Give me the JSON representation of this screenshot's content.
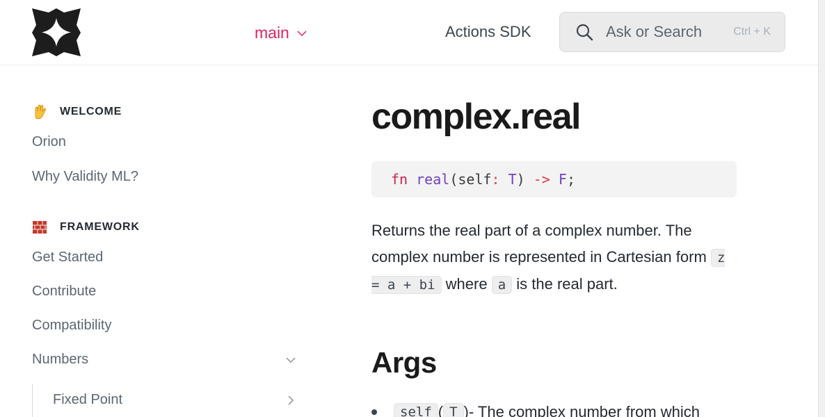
{
  "header": {
    "logo_name": "diamond-star-logo",
    "version": "main",
    "sdk_link": "Actions SDK",
    "search": {
      "placeholder": "Ask or Search",
      "shortcut": "Ctrl + K"
    }
  },
  "sidebar": {
    "sections": [
      {
        "emoji": "waving-hand",
        "title": "WELCOME",
        "items": [
          "Orion",
          "Why Validity ML?"
        ]
      },
      {
        "emoji": "brick",
        "title": "FRAMEWORK",
        "items": [
          "Get Started",
          "Contribute",
          "Compatibility",
          "Numbers"
        ]
      }
    ],
    "subitems": [
      "Fixed Point"
    ]
  },
  "content": {
    "title": "complex.real",
    "signature": {
      "kw": "fn",
      "name": "real",
      "open": "(",
      "param": "self",
      "colon": ":",
      "ptype": "T",
      "close": ")",
      "arrow": "->",
      "ret": "F",
      "semi": ";"
    },
    "desc_1": "Returns the real part of a complex number. The complex number is represented in Cartesian form",
    "desc_code_1": "z = a + bi",
    "desc_2": "where",
    "desc_code_2": "a",
    "desc_3": "is the real part.",
    "args_heading": "Args",
    "arg1_code": "self",
    "arg1_paren_open": "(",
    "arg1_type": "T",
    "arg1_paren_close": ")",
    "arg1_text": " - The complex number from which"
  },
  "colors": {
    "accent": "#e0245e",
    "text": "#242a31",
    "muted": "#5c6670"
  }
}
